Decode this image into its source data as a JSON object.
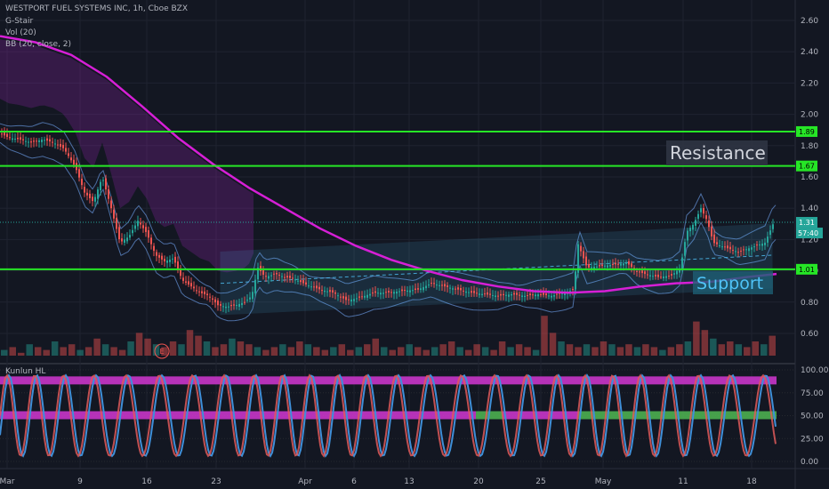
{
  "header": {
    "title": "WESTPORT FUEL SYSTEMS INC, 1h, Cboe BZX",
    "indicators": [
      "G-Stair",
      "Vol (20)",
      "BB (20, close, 2)"
    ],
    "oscillator_title": "Kunlun HL"
  },
  "annotations": {
    "resistance": "Resistance",
    "support": "Support",
    "earnings_marker": "E"
  },
  "colors": {
    "background": "#131722",
    "up": "#26a69a",
    "down": "#ef5350",
    "ma": "#d61fd6",
    "level_line": "#26e626",
    "channel": "#4fc3f7",
    "bollinger": "#5d86c5",
    "osc_fast": "#e05a5a",
    "osc_slow": "#3f8fd8",
    "band_magenta": "#c935c9",
    "band_green": "#4caf50"
  },
  "chart_data": [
    {
      "type": "line",
      "title": "WESTPORT FUEL SYSTEMS INC, 1h, Cboe BZX",
      "x_tick_labels": [
        "Mar",
        "9",
        "16",
        "23",
        "Apr",
        "6",
        "13",
        "20",
        "25",
        "May",
        "11",
        "18"
      ],
      "y_tick_labels": [
        "2.60",
        "2.40",
        "2.20",
        "2.00",
        "1.80",
        "1.60",
        "1.40",
        "1.20",
        "1.00",
        "0.80",
        "0.60"
      ],
      "ylim": [
        0.52,
        2.7
      ],
      "price_labels": {
        "level_1": "1.89",
        "level_2": "1.67",
        "level_3": "1.01",
        "last_price": "1.31",
        "countdown": "57:40"
      },
      "horizontal_levels": [
        1.89,
        1.67,
        1.01
      ],
      "series": [
        {
          "kind": "price",
          "points": [
            [
              0,
              1.88
            ],
            [
              10,
              1.85
            ],
            [
              22,
              1.84
            ],
            [
              35,
              1.82
            ],
            [
              48,
              1.84
            ],
            [
              60,
              1.82
            ],
            [
              72,
              1.78
            ],
            [
              85,
              1.66
            ],
            [
              95,
              1.5
            ],
            [
              105,
              1.44
            ],
            [
              115,
              1.6
            ],
            [
              125,
              1.4
            ],
            [
              135,
              1.18
            ],
            [
              145,
              1.22
            ],
            [
              155,
              1.32
            ],
            [
              165,
              1.24
            ],
            [
              175,
              1.1
            ],
            [
              185,
              1.06
            ],
            [
              195,
              1.08
            ],
            [
              205,
              0.94
            ],
            [
              215,
              0.9
            ],
            [
              225,
              0.86
            ],
            [
              235,
              0.84
            ],
            [
              245,
              0.78
            ],
            [
              255,
              0.77
            ],
            [
              265,
              0.78
            ],
            [
              275,
              0.8
            ],
            [
              283,
              0.84
            ],
            [
              290,
              1.02
            ],
            [
              298,
              0.96
            ],
            [
              310,
              0.98
            ],
            [
              320,
              0.96
            ],
            [
              330,
              0.95
            ],
            [
              345,
              0.91
            ],
            [
              360,
              0.88
            ],
            [
              375,
              0.86
            ],
            [
              390,
              0.81
            ],
            [
              405,
              0.83
            ],
            [
              420,
              0.86
            ],
            [
              435,
              0.86
            ],
            [
              450,
              0.87
            ],
            [
              470,
              0.88
            ],
            [
              485,
              0.92
            ],
            [
              500,
              0.9
            ],
            [
              515,
              0.88
            ],
            [
              530,
              0.86
            ],
            [
              545,
              0.85
            ],
            [
              560,
              0.84
            ],
            [
              575,
              0.85
            ],
            [
              590,
              0.84
            ],
            [
              605,
              0.85
            ],
            [
              620,
              0.84
            ],
            [
              635,
              0.86
            ],
            [
              645,
              0.88
            ],
            [
              650,
              1.17
            ],
            [
              660,
              1.02
            ],
            [
              675,
              1.03
            ],
            [
              690,
              1.04
            ],
            [
              705,
              1.05
            ],
            [
              715,
              1.0
            ],
            [
              725,
              0.98
            ],
            [
              740,
              0.96
            ],
            [
              755,
              0.97
            ],
            [
              765,
              1.02
            ],
            [
              772,
              1.25
            ],
            [
              780,
              1.3
            ],
            [
              788,
              1.4
            ],
            [
              795,
              1.32
            ],
            [
              802,
              1.18
            ],
            [
              810,
              1.16
            ],
            [
              820,
              1.14
            ],
            [
              830,
              1.12
            ],
            [
              840,
              1.14
            ],
            [
              850,
              1.16
            ],
            [
              860,
              1.18
            ],
            [
              870,
              1.31
            ]
          ]
        },
        {
          "kind": "moving_average",
          "points": [
            [
              0,
              2.5
            ],
            [
              40,
              2.46
            ],
            [
              80,
              2.38
            ],
            [
              120,
              2.24
            ],
            [
              160,
              2.05
            ],
            [
              200,
              1.85
            ],
            [
              240,
              1.68
            ],
            [
              280,
              1.53
            ],
            [
              320,
              1.4
            ],
            [
              360,
              1.27
            ],
            [
              400,
              1.16
            ],
            [
              440,
              1.07
            ],
            [
              480,
              1.0
            ],
            [
              520,
              0.94
            ],
            [
              560,
              0.9
            ],
            [
              600,
              0.87
            ],
            [
              640,
              0.86
            ],
            [
              680,
              0.87
            ],
            [
              720,
              0.9
            ],
            [
              760,
              0.92
            ],
            [
              800,
              0.93
            ],
            [
              840,
              0.96
            ],
            [
              873,
              0.98
            ]
          ]
        }
      ],
      "volume": [
        2,
        3,
        1,
        4,
        3,
        2,
        5,
        3,
        4,
        2,
        3,
        6,
        4,
        3,
        2,
        5,
        8,
        6,
        4,
        3,
        5,
        4,
        9,
        7,
        5,
        3,
        4,
        6,
        5,
        4,
        3,
        2,
        3,
        4,
        3,
        5,
        4,
        3,
        2,
        3,
        4,
        2,
        3,
        4,
        6,
        3,
        2,
        3,
        4,
        3,
        2,
        3,
        4,
        5,
        3,
        2,
        4,
        3,
        2,
        5,
        3,
        4,
        3,
        2,
        14,
        8,
        5,
        4,
        3,
        4,
        3,
        5,
        4,
        3,
        4,
        3,
        4,
        3,
        2,
        3,
        4,
        5,
        12,
        9,
        6,
        4,
        5,
        4,
        3,
        5,
        4,
        7
      ],
      "ylabel": "",
      "xlabel": ""
    },
    {
      "type": "line",
      "title": "Kunlun HL",
      "y_tick_labels": [
        "100.00",
        "75.00",
        "50.00",
        "25.00",
        "0.00"
      ],
      "ylim": [
        -5,
        105
      ],
      "period": 34,
      "bands": [
        {
          "y": 88,
          "color": "magenta",
          "x0": 0,
          "x1": 873
        },
        {
          "y": 50,
          "color": "magenta",
          "x0": 0,
          "x1": 535
        },
        {
          "y": 50,
          "color": "green",
          "x0": 535,
          "x1": 565
        },
        {
          "y": 50,
          "color": "magenta",
          "x0": 565,
          "x1": 650
        },
        {
          "y": 50,
          "color": "green",
          "x0": 650,
          "x1": 873
        }
      ]
    }
  ]
}
